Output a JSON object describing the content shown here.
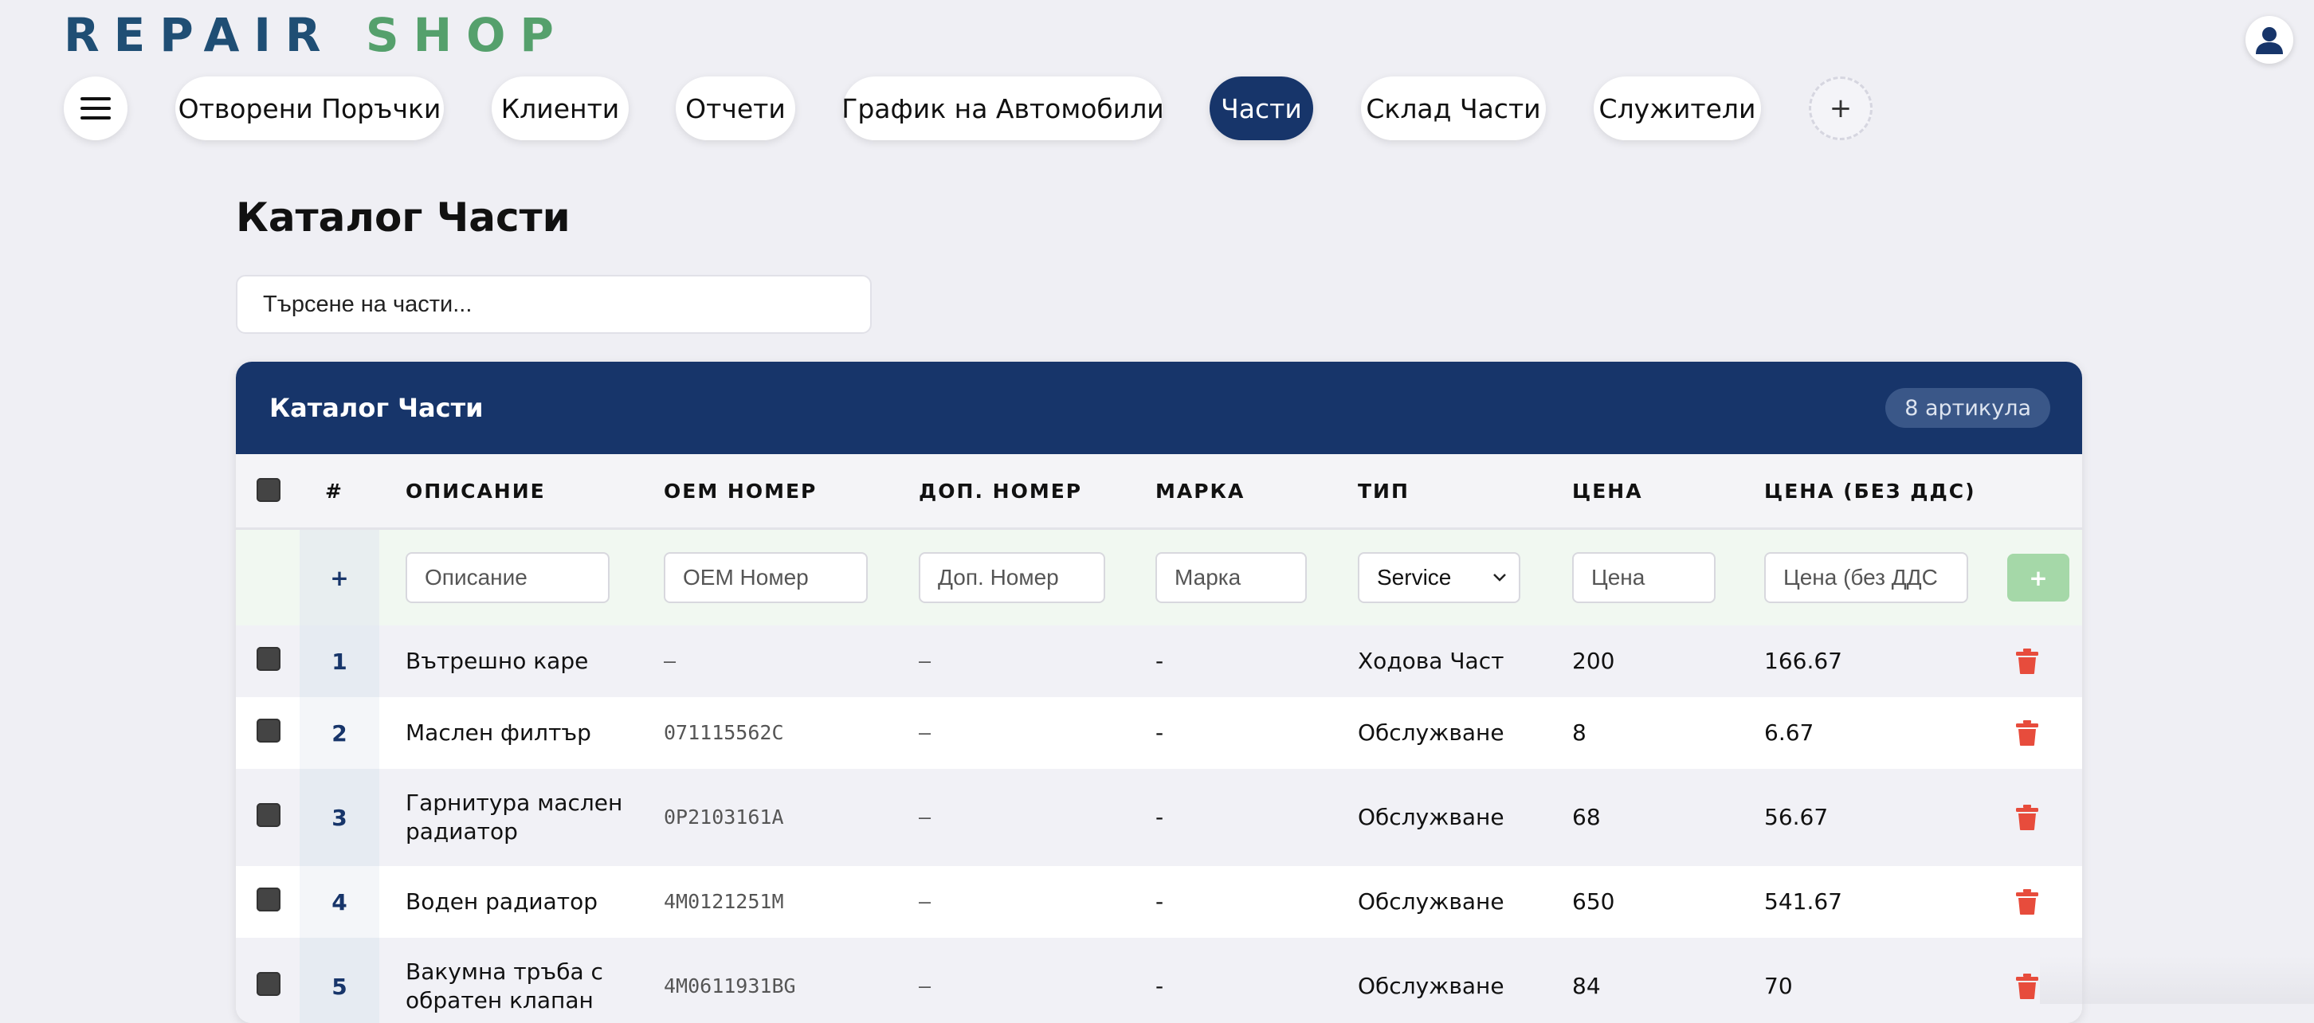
{
  "app": {
    "logo_word1": "REPAIR",
    "logo_word2": "SHOP"
  },
  "colors": {
    "primary": "#17356a",
    "logo_blue": "#1f4e74",
    "logo_green": "#55a06c",
    "delete_red": "#e74c3c",
    "add_green": "#a5d8a8"
  },
  "nav": {
    "menu_icon": "hamburger-menu-icon",
    "tabs": [
      {
        "label": "Отворени Поръчки",
        "active": false
      },
      {
        "label": "Клиенти",
        "active": false
      },
      {
        "label": "Отчети",
        "active": false
      },
      {
        "label": "График на Автомобили",
        "active": false
      },
      {
        "label": "Части",
        "active": true
      },
      {
        "label": "Склад Части",
        "active": false
      },
      {
        "label": "Служители",
        "active": false
      }
    ],
    "add_label": "+"
  },
  "user_icon": "user-avatar-icon",
  "page": {
    "title": "Каталог Части"
  },
  "search": {
    "placeholder": "Търсене на части..."
  },
  "table": {
    "title": "Каталог Части",
    "count": "8 артикула",
    "headers": [
      "#",
      "ОПИСАНИЕ",
      "ОЕМ НОМЕР",
      "ДОП. НОМЕР",
      "МАРКА",
      "ТИП",
      "ЦЕНА",
      "ЦЕНА (БЕЗ ДДС)"
    ],
    "add_row": {
      "num_label": "+",
      "desc_placeholder": "Описание",
      "oem_placeholder": "OEM Номер",
      "extra_placeholder": "Доп. Номер",
      "brand_placeholder": "Марка",
      "type_value": "Service",
      "price_placeholder": "Цена",
      "price_net_placeholder": "Цена (без ДДС",
      "add_button": "+"
    },
    "rows": [
      {
        "num": "1",
        "desc": "Вътрешно каре",
        "oem": "–",
        "extra": "–",
        "brand": "-",
        "type": "Ходова Част",
        "price": "200",
        "price_net": "166.67"
      },
      {
        "num": "2",
        "desc": "Маслен филтър",
        "oem": "071115562C",
        "extra": "–",
        "brand": "-",
        "type": "Обслужване",
        "price": "8",
        "price_net": "6.67"
      },
      {
        "num": "3",
        "desc": "Гарнитура маслен радиатор",
        "oem": "0P2103161A",
        "extra": "–",
        "brand": "-",
        "type": "Обслужване",
        "price": "68",
        "price_net": "56.67"
      },
      {
        "num": "4",
        "desc": "Воден радиатор",
        "oem": "4M0121251M",
        "extra": "–",
        "brand": "-",
        "type": "Обслужване",
        "price": "650",
        "price_net": "541.67"
      },
      {
        "num": "5",
        "desc": "Вакумна тръба с обратен клапан",
        "oem": "4M0611931BG",
        "extra": "–",
        "brand": "-",
        "type": "Обслужване",
        "price": "84",
        "price_net": "70"
      }
    ]
  }
}
